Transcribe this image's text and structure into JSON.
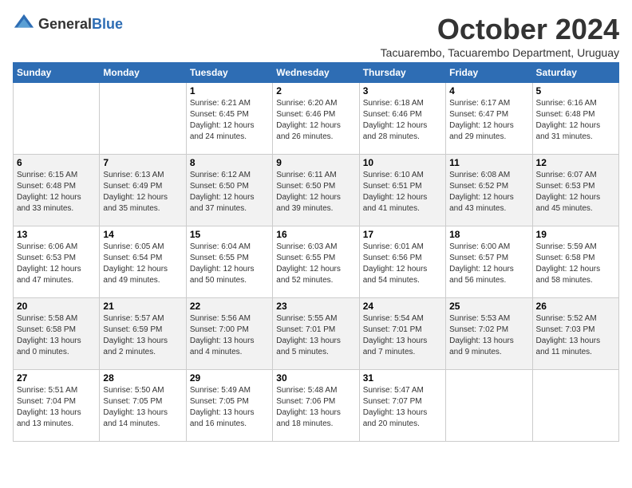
{
  "header": {
    "logo_general": "General",
    "logo_blue": "Blue",
    "month_title": "October 2024",
    "subtitle": "Tacuarembo, Tacuarembo Department, Uruguay"
  },
  "days_of_week": [
    "Sunday",
    "Monday",
    "Tuesday",
    "Wednesday",
    "Thursday",
    "Friday",
    "Saturday"
  ],
  "weeks": [
    [
      {
        "day": "",
        "info": ""
      },
      {
        "day": "",
        "info": ""
      },
      {
        "day": "1",
        "info": "Sunrise: 6:21 AM\nSunset: 6:45 PM\nDaylight: 12 hours and 24 minutes."
      },
      {
        "day": "2",
        "info": "Sunrise: 6:20 AM\nSunset: 6:46 PM\nDaylight: 12 hours and 26 minutes."
      },
      {
        "day": "3",
        "info": "Sunrise: 6:18 AM\nSunset: 6:46 PM\nDaylight: 12 hours and 28 minutes."
      },
      {
        "day": "4",
        "info": "Sunrise: 6:17 AM\nSunset: 6:47 PM\nDaylight: 12 hours and 29 minutes."
      },
      {
        "day": "5",
        "info": "Sunrise: 6:16 AM\nSunset: 6:48 PM\nDaylight: 12 hours and 31 minutes."
      }
    ],
    [
      {
        "day": "6",
        "info": "Sunrise: 6:15 AM\nSunset: 6:48 PM\nDaylight: 12 hours and 33 minutes."
      },
      {
        "day": "7",
        "info": "Sunrise: 6:13 AM\nSunset: 6:49 PM\nDaylight: 12 hours and 35 minutes."
      },
      {
        "day": "8",
        "info": "Sunrise: 6:12 AM\nSunset: 6:50 PM\nDaylight: 12 hours and 37 minutes."
      },
      {
        "day": "9",
        "info": "Sunrise: 6:11 AM\nSunset: 6:50 PM\nDaylight: 12 hours and 39 minutes."
      },
      {
        "day": "10",
        "info": "Sunrise: 6:10 AM\nSunset: 6:51 PM\nDaylight: 12 hours and 41 minutes."
      },
      {
        "day": "11",
        "info": "Sunrise: 6:08 AM\nSunset: 6:52 PM\nDaylight: 12 hours and 43 minutes."
      },
      {
        "day": "12",
        "info": "Sunrise: 6:07 AM\nSunset: 6:53 PM\nDaylight: 12 hours and 45 minutes."
      }
    ],
    [
      {
        "day": "13",
        "info": "Sunrise: 6:06 AM\nSunset: 6:53 PM\nDaylight: 12 hours and 47 minutes."
      },
      {
        "day": "14",
        "info": "Sunrise: 6:05 AM\nSunset: 6:54 PM\nDaylight: 12 hours and 49 minutes."
      },
      {
        "day": "15",
        "info": "Sunrise: 6:04 AM\nSunset: 6:55 PM\nDaylight: 12 hours and 50 minutes."
      },
      {
        "day": "16",
        "info": "Sunrise: 6:03 AM\nSunset: 6:55 PM\nDaylight: 12 hours and 52 minutes."
      },
      {
        "day": "17",
        "info": "Sunrise: 6:01 AM\nSunset: 6:56 PM\nDaylight: 12 hours and 54 minutes."
      },
      {
        "day": "18",
        "info": "Sunrise: 6:00 AM\nSunset: 6:57 PM\nDaylight: 12 hours and 56 minutes."
      },
      {
        "day": "19",
        "info": "Sunrise: 5:59 AM\nSunset: 6:58 PM\nDaylight: 12 hours and 58 minutes."
      }
    ],
    [
      {
        "day": "20",
        "info": "Sunrise: 5:58 AM\nSunset: 6:58 PM\nDaylight: 13 hours and 0 minutes."
      },
      {
        "day": "21",
        "info": "Sunrise: 5:57 AM\nSunset: 6:59 PM\nDaylight: 13 hours and 2 minutes."
      },
      {
        "day": "22",
        "info": "Sunrise: 5:56 AM\nSunset: 7:00 PM\nDaylight: 13 hours and 4 minutes."
      },
      {
        "day": "23",
        "info": "Sunrise: 5:55 AM\nSunset: 7:01 PM\nDaylight: 13 hours and 5 minutes."
      },
      {
        "day": "24",
        "info": "Sunrise: 5:54 AM\nSunset: 7:01 PM\nDaylight: 13 hours and 7 minutes."
      },
      {
        "day": "25",
        "info": "Sunrise: 5:53 AM\nSunset: 7:02 PM\nDaylight: 13 hours and 9 minutes."
      },
      {
        "day": "26",
        "info": "Sunrise: 5:52 AM\nSunset: 7:03 PM\nDaylight: 13 hours and 11 minutes."
      }
    ],
    [
      {
        "day": "27",
        "info": "Sunrise: 5:51 AM\nSunset: 7:04 PM\nDaylight: 13 hours and 13 minutes."
      },
      {
        "day": "28",
        "info": "Sunrise: 5:50 AM\nSunset: 7:05 PM\nDaylight: 13 hours and 14 minutes."
      },
      {
        "day": "29",
        "info": "Sunrise: 5:49 AM\nSunset: 7:05 PM\nDaylight: 13 hours and 16 minutes."
      },
      {
        "day": "30",
        "info": "Sunrise: 5:48 AM\nSunset: 7:06 PM\nDaylight: 13 hours and 18 minutes."
      },
      {
        "day": "31",
        "info": "Sunrise: 5:47 AM\nSunset: 7:07 PM\nDaylight: 13 hours and 20 minutes."
      },
      {
        "day": "",
        "info": ""
      },
      {
        "day": "",
        "info": ""
      }
    ]
  ]
}
